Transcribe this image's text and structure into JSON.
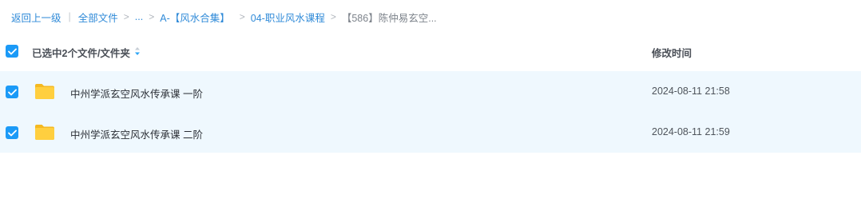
{
  "breadcrumb": {
    "back_label": "返回上一级",
    "separator_pipe": "|",
    "root_label": "全部文件",
    "ellipsis_label": "...",
    "level1_label": "A-【风水合集】",
    "level2_label": "04-职业风水课程",
    "current_label": "【586】陈仲易玄空...",
    "chevron": ">"
  },
  "header": {
    "selection_label": "已选中2个文件/文件夹",
    "mtime_column_label": "修改时间"
  },
  "files": [
    {
      "name": "中州学派玄空风水传承课 一阶",
      "mtime": "2024-08-11 21:58",
      "checked": true,
      "type": "folder"
    },
    {
      "name": "中州学派玄空风水传承课 二阶",
      "mtime": "2024-08-11 21:59",
      "checked": true,
      "type": "folder"
    }
  ],
  "colors": {
    "accent": "#1b9af7",
    "link": "#2f8ad8",
    "row_selected_bg": "#eff8fe",
    "folder_yellow": "#ffc93c"
  },
  "icons": [
    "check-icon",
    "sort-icon",
    "folder-icon",
    "chevron-right-icon"
  ]
}
